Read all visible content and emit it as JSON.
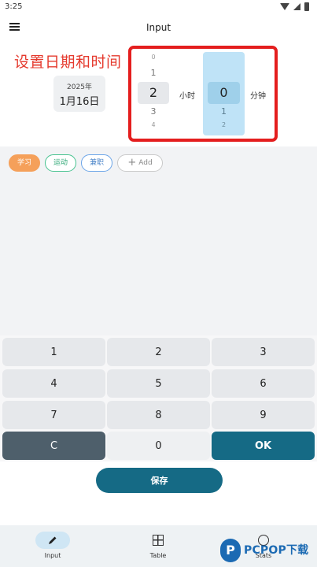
{
  "status_bar": {
    "time": "3:25"
  },
  "app_bar": {
    "title": "Input"
  },
  "annotation": {
    "text": "设置日期和时间"
  },
  "date_card": {
    "year": "2025年",
    "day": "1月16日"
  },
  "picker": {
    "hours": {
      "above2": "0",
      "above1": "1",
      "selected": "2",
      "below1": "3",
      "below2": "4",
      "unit": "小时"
    },
    "minutes": {
      "selected": "0",
      "below1": "1",
      "below2": "2",
      "unit": "分钟"
    }
  },
  "tags": {
    "study": "学习",
    "sport": "运动",
    "part_time": "兼职",
    "add": "Add"
  },
  "keypad": {
    "k1": "1",
    "k2": "2",
    "k3": "3",
    "k4": "4",
    "k5": "5",
    "k6": "6",
    "k7": "7",
    "k8": "8",
    "k9": "9",
    "clear": "C",
    "k0": "0",
    "ok": "OK"
  },
  "save_label": "保存",
  "nav": {
    "input": "Input",
    "table": "Table",
    "stats": "Stats"
  },
  "watermark": {
    "badge": "P",
    "text": "PCPOP下载"
  },
  "colors": {
    "accent": "#156a85",
    "highlight": "#e41e1e",
    "study": "#f5a05a",
    "sport": "#46c28f",
    "part_time": "#6aa4e8"
  }
}
